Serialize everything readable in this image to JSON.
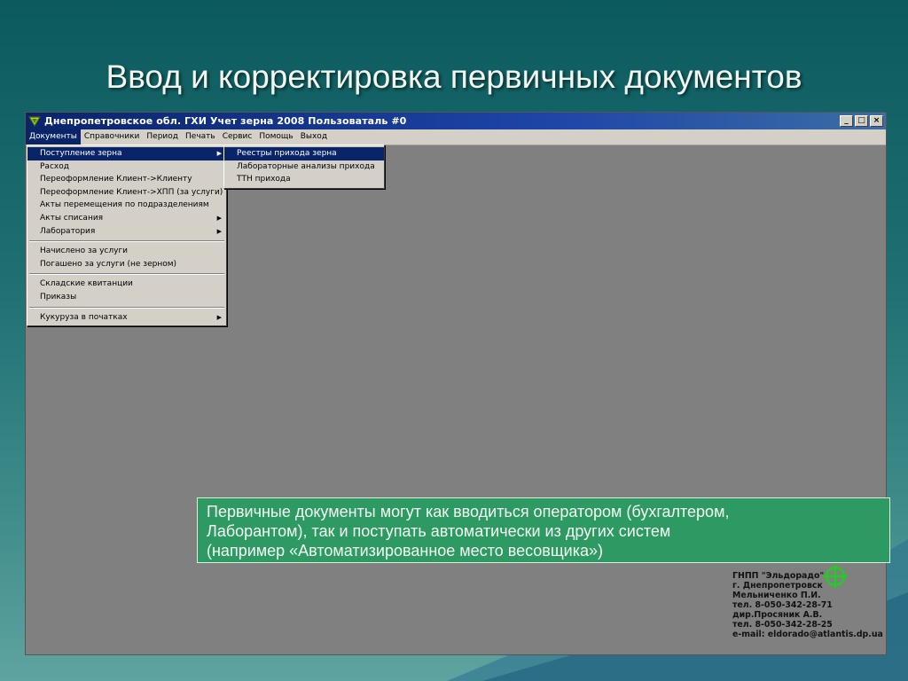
{
  "slide": {
    "title": "Ввод и корректировка первичных документов"
  },
  "window": {
    "title": "Днепропетровское  обл. ГХИ Учет зерна 2008 Пользоваталь #0",
    "buttons": {
      "minimize": "_",
      "maximize": "□",
      "close": "×"
    }
  },
  "menubar": [
    {
      "label": "Документы",
      "active": true
    },
    {
      "label": "Справочники"
    },
    {
      "label": "Период"
    },
    {
      "label": "Печать"
    },
    {
      "label": "Сервис"
    },
    {
      "label": "Помощь"
    },
    {
      "label": "Выход"
    }
  ],
  "documents_menu": {
    "groups": [
      [
        {
          "label": "Поступление зерна",
          "submenu": true,
          "highlighted": true
        },
        {
          "label": "Расход"
        },
        {
          "label": "Переоформление Клиент->Клиенту"
        },
        {
          "label": "Переоформление Клиент->ХПП (за услуги)"
        },
        {
          "label": "Акты перемещения по подразделениям"
        },
        {
          "label": "Акты списания",
          "submenu": true
        },
        {
          "label": "Лаборатория",
          "submenu": true
        }
      ],
      [
        {
          "label": "Начислено  за услуги"
        },
        {
          "label": "Погашено за услуги (не зерном)"
        }
      ],
      [
        {
          "label": "Складские квитанции"
        },
        {
          "label": "Приказы"
        }
      ],
      [
        {
          "label": "Кукуруза в початках",
          "submenu": true
        }
      ]
    ]
  },
  "grain_income_submenu": [
    {
      "label": "Реестры прихода зерна",
      "highlighted": true
    },
    {
      "label": "Лабораторные анализы прихода"
    },
    {
      "label": "ТТН прихода"
    }
  ],
  "info_box": {
    "lines": [
      "Первичные документы могут как вводиться оператором (бухгалтером,",
      "Лаборантом), так и поступать автоматически из других систем",
      "(например «Автоматизированное место весовщика»)"
    ]
  },
  "company": {
    "lines": [
      "ГНПП \"Эльдорадо\"",
      "г. Днепропетровск",
      "Мельниченко П.И.",
      "тел. 8-050-342-28-71",
      "дир.Просяник А.В.",
      "тел. 8-050-342-28-25",
      "e-mail: eldorado@atlantis.dp.ua"
    ]
  },
  "colors": {
    "titlebar": "#0a246a",
    "menu_highlight": "#0a246a",
    "workspace": "#808080",
    "info_box": "#2e9a63"
  }
}
